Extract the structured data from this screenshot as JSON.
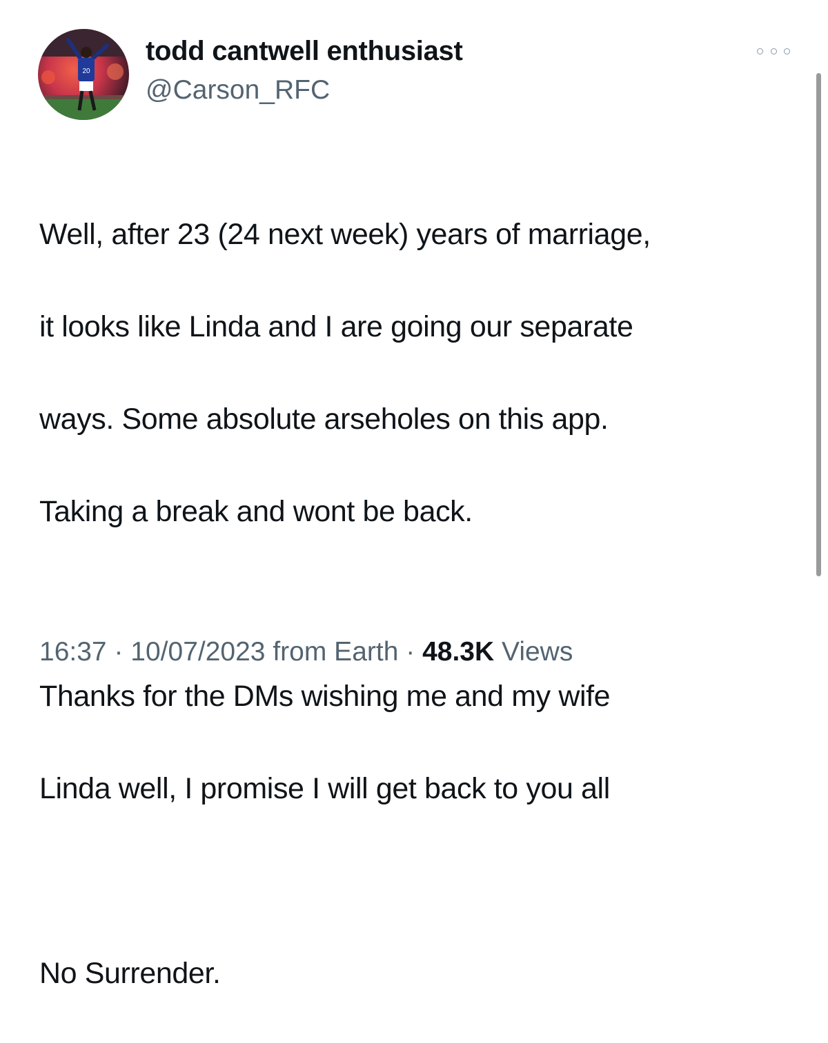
{
  "tweet": {
    "display_name": "todd cantwell enthusiast",
    "handle": "@Carson_RFC",
    "more_icon": "more-horizontal-icon",
    "avatar_jersey_number": "20",
    "paragraphs": [
      [
        "Well, after 23 (24 next week) years of marriage,",
        "it looks like Linda and I are going our separate",
        "ways. Some absolute arseholes on this app.",
        "Taking a break and wont be back."
      ],
      [
        "Thanks for the DMs wishing me and my wife",
        "Linda well, I promise I will get back to you all"
      ],
      [
        "No Surrender."
      ]
    ],
    "time": "16:37",
    "separator": "·",
    "date": "10/07/2023",
    "source": "from Earth",
    "views_count": "48.3K",
    "views_label": "Views"
  },
  "colors": {
    "text": "#0f1419",
    "secondary": "#536471"
  }
}
